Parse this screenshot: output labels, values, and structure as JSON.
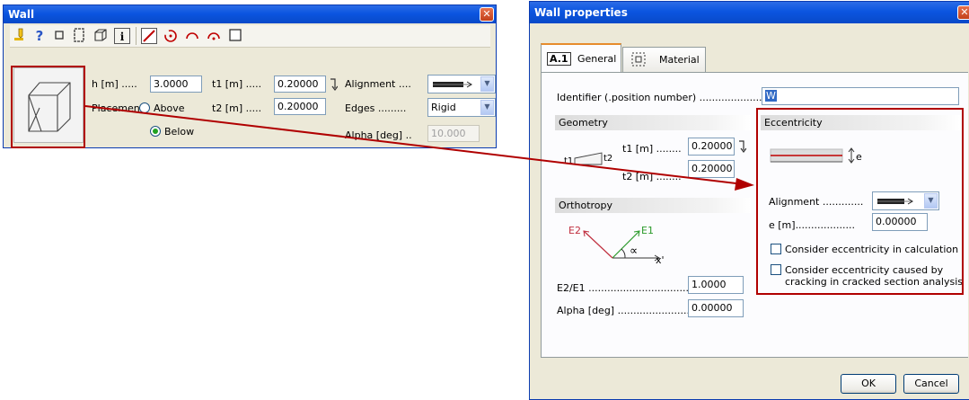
{
  "wall_dialog": {
    "title": "Wall",
    "close_glyph": "✕",
    "toolbar": [
      "pencil-icon",
      "help-icon",
      "square-icon",
      "rectangle-icon",
      "box-icon",
      "info-icon",
      "line-icon",
      "arc-icon",
      "arc-cw-icon",
      "arc-ccw-icon",
      "rect-outline-icon"
    ],
    "help_glyph": "?",
    "info_glyph": "i",
    "h_label": "h [m] .....",
    "h_value": "3.0000",
    "t1_label": "t1 [m] .....",
    "t1_value": "0.20000",
    "t2_label": "t2 [m] .....",
    "t2_value": "0.20000",
    "placement_label": "Placement",
    "above_label": "Above",
    "below_label": "Below",
    "placement_selected": "Below",
    "alignment_label": "Alignment ....",
    "edges_label": "Edges .........",
    "edges_value": "Rigid",
    "alpha_label": "Alpha [deg] ..",
    "alpha_value": "10.000"
  },
  "properties_dialog": {
    "title": "Wall properties",
    "tabs": [
      {
        "badge": "A.1",
        "label": "General",
        "active": true
      },
      {
        "label": "Material",
        "active": false
      }
    ],
    "identifier_label": "Identifier (.position number) .......................",
    "identifier_value": "W",
    "geometry": {
      "header": "Geometry",
      "t1_label": "t1 [m] ........",
      "t1_value": "0.20000",
      "t2_label": "t2 [m] ........",
      "t2_value": "0.20000",
      "diagram_t1": "t1",
      "diagram_t2": "t2"
    },
    "orthotropy": {
      "header": "Orthotropy",
      "e2_label": "E2",
      "e1_label": "E1",
      "alpha_symbol": "∝",
      "x_label": "x'",
      "ratio_label": "E2/E1 .................................",
      "ratio_value": "1.0000",
      "alpha_label": "Alpha [deg] ........................",
      "alpha_value": "0.00000"
    },
    "eccentricity": {
      "header": "Eccentricity",
      "e_symbol": "e",
      "alignment_label": "Alignment .............",
      "e_label": "e [m]...................",
      "e_value": "0.00000",
      "consider_calc": "Consider eccentricity in calculation",
      "consider_crack_line1": "Consider eccentricity caused by",
      "consider_crack_line2": "cracking in cracked section analysis"
    },
    "ok_label": "OK",
    "cancel_label": "Cancel"
  },
  "colors": {
    "annotation_red": "#b00000",
    "title_blue": "#0a55e0"
  }
}
